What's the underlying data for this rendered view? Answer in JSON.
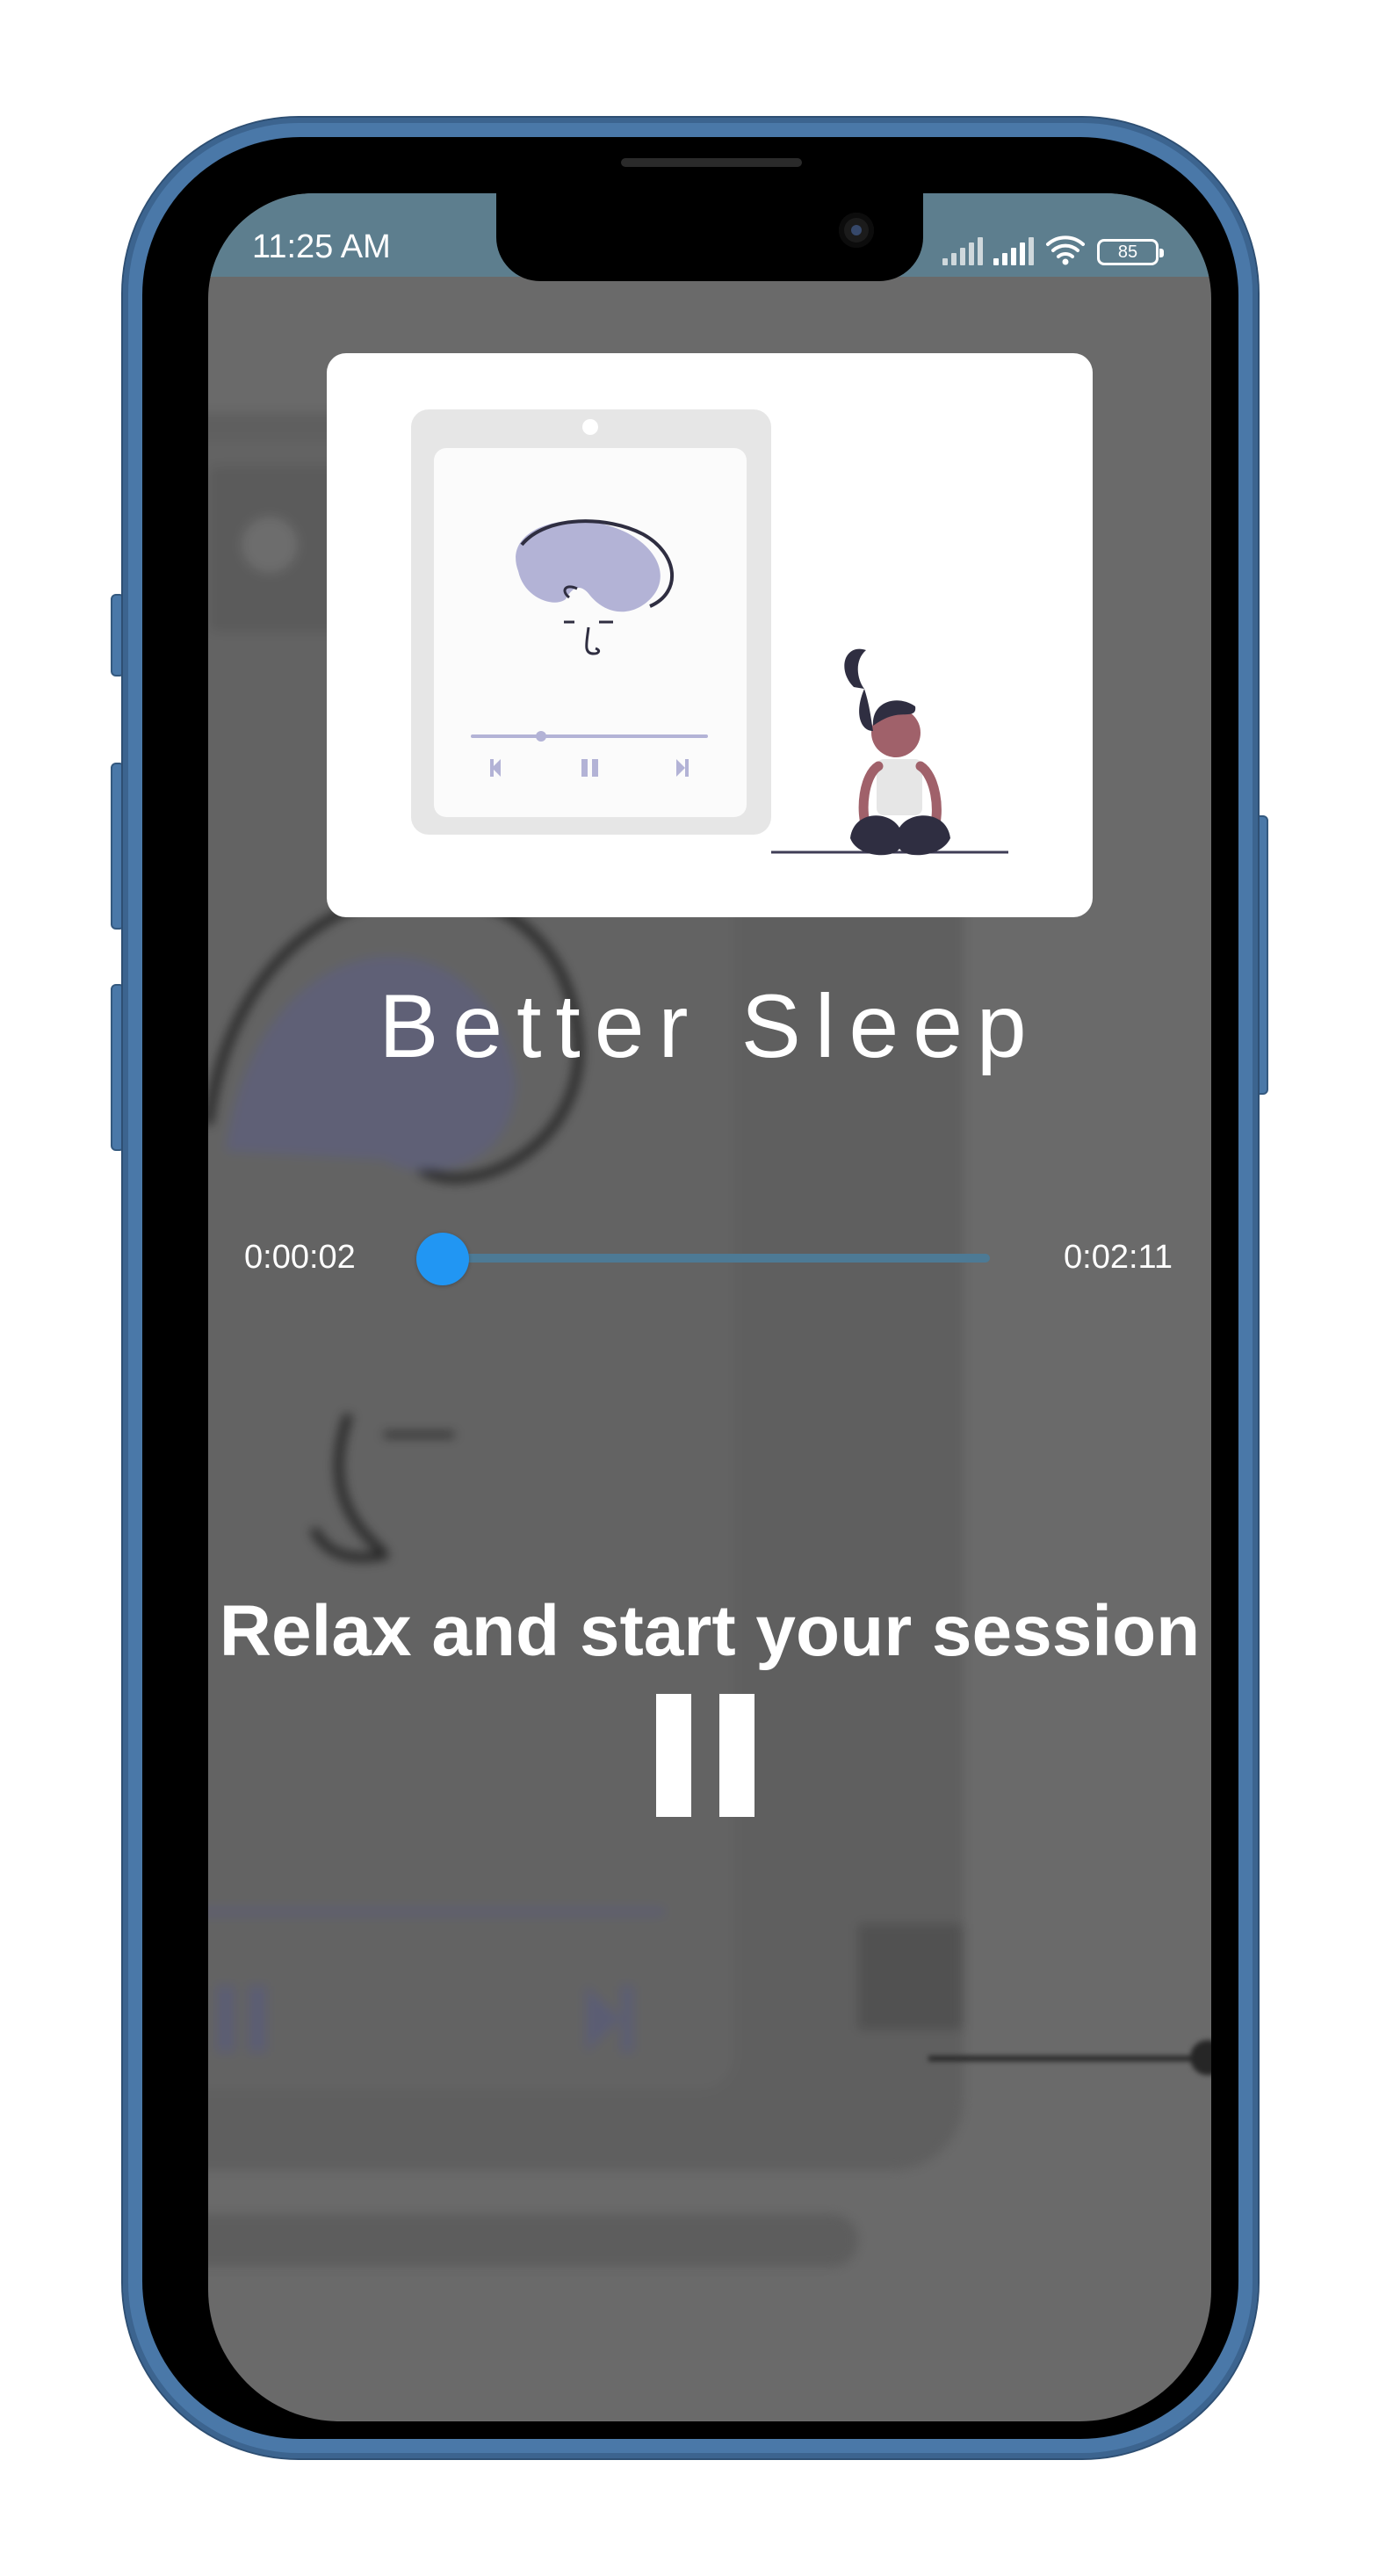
{
  "status_bar": {
    "time": "11:25 AM",
    "battery": "85"
  },
  "player": {
    "title": "Better Sleep",
    "current_time": "0:00:02",
    "total_time": "0:02:11",
    "progress": 0.015,
    "subtitle": "Relax and start your session",
    "state": "playing"
  },
  "colors": {
    "accent": "#2196f3",
    "status_bar": "#5d7e8e",
    "screen_overlay": "#6a6a6a"
  },
  "icons": {
    "pause": "pause-icon",
    "previous": "skip-previous-icon",
    "next": "skip-next-icon"
  }
}
